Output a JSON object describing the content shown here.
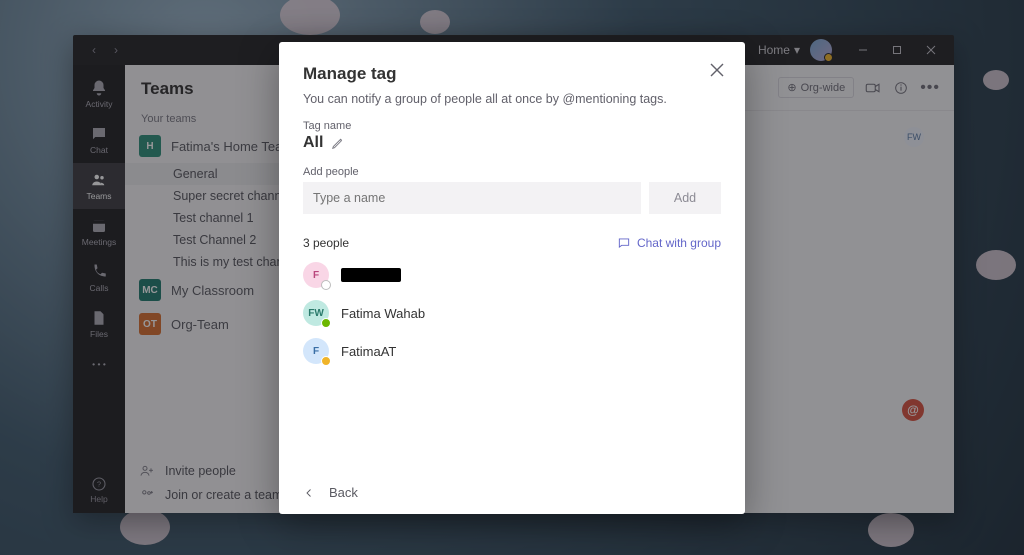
{
  "titlebar": {
    "home_label": "Home"
  },
  "rail": {
    "items": [
      {
        "label": "Activity"
      },
      {
        "label": "Chat"
      },
      {
        "label": "Teams"
      },
      {
        "label": "Meetings"
      },
      {
        "label": "Calls"
      },
      {
        "label": "Files"
      }
    ],
    "help_label": "Help"
  },
  "teams_pane": {
    "title": "Teams",
    "section_label": "Your teams",
    "teams": [
      {
        "name": "Fatima's Home Team",
        "initials": "H",
        "channels": [
          "General",
          "Super secret channel",
          "Test channel 1",
          "Test Channel 2",
          "This is my test channel"
        ]
      },
      {
        "name": "My Classroom",
        "initials": "MC"
      },
      {
        "name": "Org-Team",
        "initials": "OT"
      }
    ],
    "invite_label": "Invite people",
    "join_create_label": "Join or create a team"
  },
  "convo_header": {
    "orgwide_label": "Org-wide",
    "fw_initials": "FW"
  },
  "modal": {
    "title": "Manage tag",
    "subtitle": "You can notify a group of people all at once by @mentioning tags.",
    "tag_name_label": "Tag name",
    "tag_name_value": "All",
    "add_people_label": "Add people",
    "add_people_placeholder": "Type a name",
    "add_button": "Add",
    "people_count": "3 people",
    "chat_group_label": "Chat with group",
    "people": [
      {
        "initials": "F",
        "name_redacted": true,
        "avatar": "pink"
      },
      {
        "initials": "FW",
        "name": "Fatima Wahab",
        "avatar": "teal"
      },
      {
        "initials": "F",
        "name": "FatimaAT",
        "avatar": "blue"
      }
    ],
    "back_label": "Back"
  }
}
